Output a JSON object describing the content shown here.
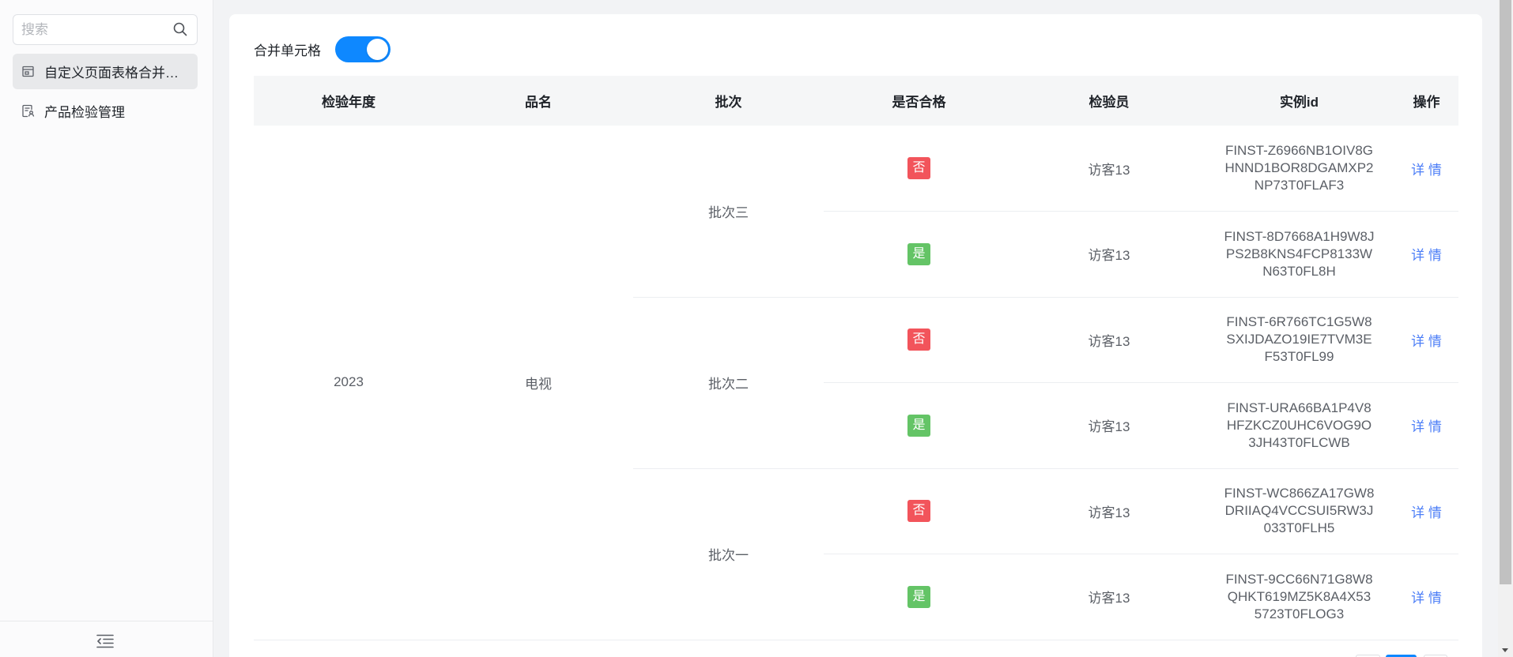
{
  "sidebar": {
    "search_placeholder": "搜索",
    "search_icon": "search-icon",
    "items": [
      {
        "label": "自定义页面表格合并…",
        "icon": "table-icon",
        "active": true
      },
      {
        "label": "产品检验管理",
        "icon": "form-icon",
        "active": false
      }
    ],
    "collapse_icon": "collapse-sidebar-icon"
  },
  "toolbar": {
    "merge_label": "合并单元格",
    "merge_enabled": true
  },
  "table": {
    "columns": [
      "检验年度",
      "品名",
      "批次",
      "是否合格",
      "检验员",
      "实例id",
      "操作"
    ],
    "merged": {
      "year": "2023",
      "product": "电视"
    },
    "batches": [
      {
        "name": "批次三",
        "records": [
          {
            "qualified": "否",
            "inspector": "访客13",
            "instance_id": "FINST-Z6966NB1OIV8GHNND1BOR8DGAMXP2NP73T0FLAF3",
            "action": "详 情"
          },
          {
            "qualified": "是",
            "inspector": "访客13",
            "instance_id": "FINST-8D7668A1H9W8JPS2B8KNS4FCP8133WN63T0FL8H",
            "action": "详 情"
          }
        ]
      },
      {
        "name": "批次二",
        "records": [
          {
            "qualified": "否",
            "inspector": "访客13",
            "instance_id": "FINST-6R766TC1G5W8SXIJDAZO19IE7TVM3EF53T0FL99",
            "action": "详 情"
          },
          {
            "qualified": "是",
            "inspector": "访客13",
            "instance_id": "FINST-URA66BA1P4V8HFZKCZ0UHC6VOG9O3JH43T0FLCWB",
            "action": "详 情"
          }
        ]
      },
      {
        "name": "批次一",
        "records": [
          {
            "qualified": "否",
            "inspector": "访客13",
            "instance_id": "FINST-WC866ZA17GW8DRIIAQ4VCCSUI5RW3J033T0FLH5",
            "action": "详 情"
          },
          {
            "qualified": "是",
            "inspector": "访客13",
            "instance_id": "FINST-9CC66N71G8W8QHKT619MZ5K8A4X535723T0FLOG3",
            "action": "详 情"
          }
        ]
      }
    ],
    "status_colors": {
      "否": "#f2545b",
      "是": "#64c466"
    }
  },
  "colors": {
    "accent": "#0e88ff",
    "link": "#4c7ef7",
    "page_background": "#f2f3f5",
    "active_nav_background": "#e8e9eb"
  }
}
